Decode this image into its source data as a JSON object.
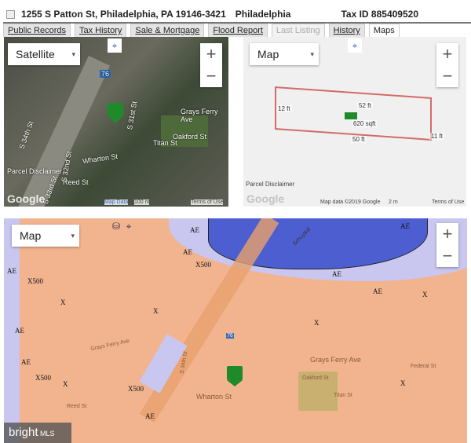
{
  "header": {
    "address": "1255 S Patton St, Philadelphia, PA 19146-3421",
    "city": "Philadelphia",
    "tax_id": "Tax ID 885409520"
  },
  "tabs": [
    {
      "label": "Public Records"
    },
    {
      "label": "Tax History"
    },
    {
      "label": "Sale & Mortgage"
    },
    {
      "label": "Flood Report"
    },
    {
      "label": "Last Listing",
      "disabled": true
    },
    {
      "label": "History"
    },
    {
      "label": "Maps",
      "active": true
    }
  ],
  "satellite_map": {
    "type_select": "Satellite",
    "zoom_in": "+",
    "zoom_out": "−",
    "streets": [
      "Grays Ferry Ave",
      "Oakford St",
      "Titan St",
      "Wharton St",
      "Reed St",
      "S 34th St",
      "S 33rd St",
      "S 32nd St",
      "S 31st St",
      "76"
    ],
    "parcel_disclaimer": "Parcel Disclaimer",
    "logo": "Google",
    "map_data": "Map Data",
    "scale": "100 m",
    "terms": "Terms of Use"
  },
  "parcel_map": {
    "type_select": "Map",
    "zoom_in": "+",
    "zoom_out": "−",
    "dimensions": [
      "52 ft",
      "12 ft",
      "620 sqft",
      "50 ft",
      "11 ft"
    ],
    "parcel_disclaimer": "Parcel Disclaimer",
    "logo": "Google",
    "map_data": "Map data ©2019 Google",
    "scale": "2 m",
    "terms": "Terms of Use"
  },
  "flood_map": {
    "type_select": "Map",
    "zoom_in": "+",
    "zoom_out": "−",
    "zones": [
      "AE",
      "AE",
      "AE",
      "X500",
      "AE",
      "X500",
      "X",
      "X",
      "AE",
      "AE",
      "X",
      "X",
      "AE",
      "AE",
      "X500",
      "X",
      "X500",
      "X",
      "AE"
    ],
    "streets": [
      "Grays Ferry Ave",
      "Grays Ferry Ave",
      "Wharton St",
      "Titan St",
      "Oakford St",
      "Federal St",
      "Reed St",
      "S 34th St",
      "Schuylkill",
      "76"
    ],
    "watermark": "bright MLS"
  },
  "colors": {
    "flood_x": "#f2b48f",
    "flood_ae": "#c9c6ef",
    "flood_x500": "#eef0a0",
    "water": "#4d5fd0",
    "pin": "#1f8a2a"
  }
}
